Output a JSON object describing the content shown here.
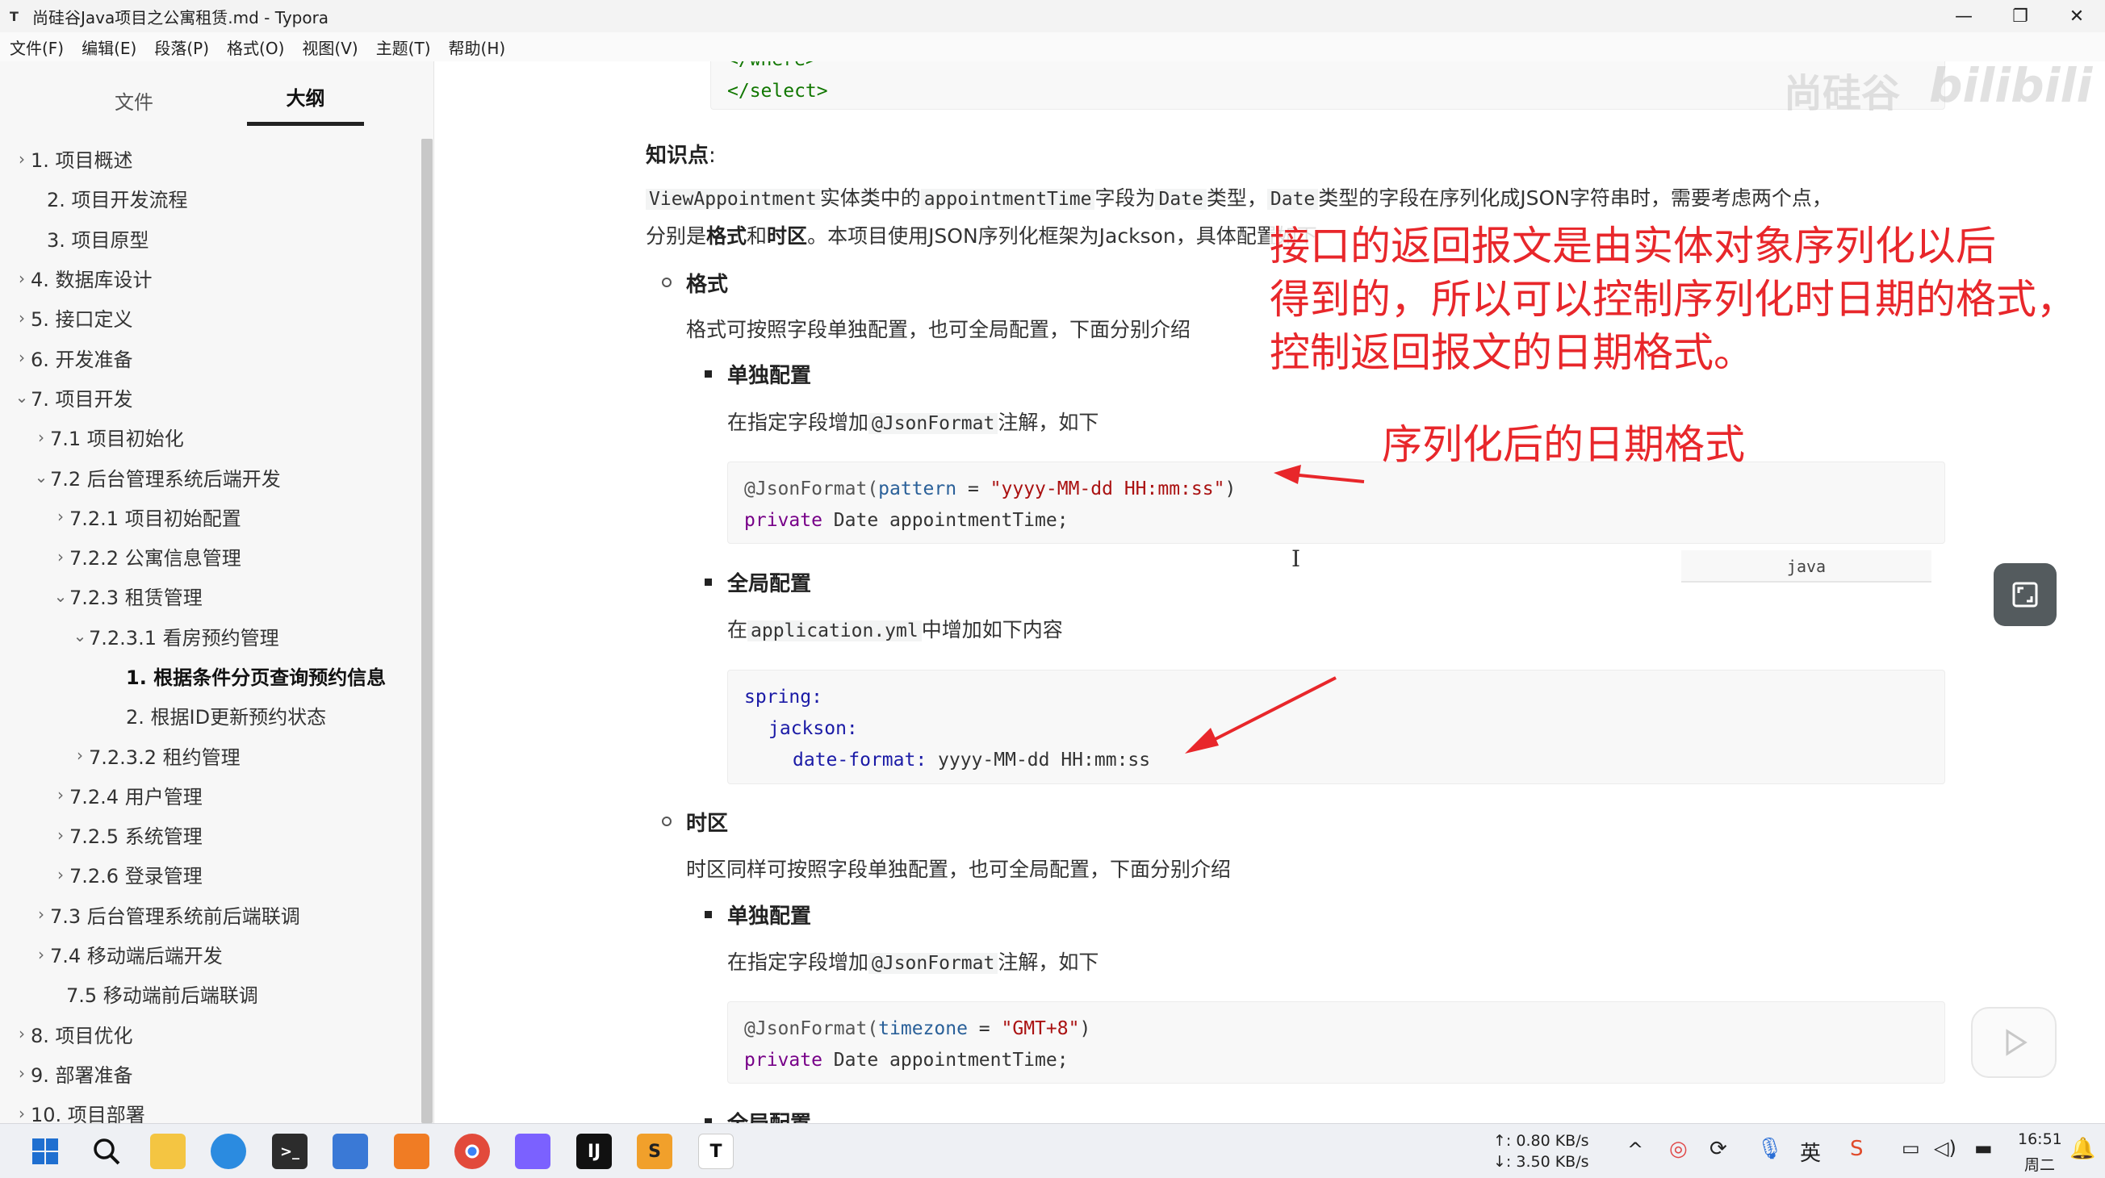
{
  "window": {
    "title": "尚硅谷Java项目之公寓租赁.md - Typora",
    "app_icon": "T",
    "controls": [
      "—",
      "❐",
      "✕"
    ]
  },
  "menu": [
    "文件(F)",
    "编辑(E)",
    "段落(P)",
    "格式(O)",
    "视图(V)",
    "主题(T)",
    "帮助(H)"
  ],
  "sidebar": {
    "tabs": [
      "文件",
      "大纲"
    ],
    "active_tab": "大纲",
    "outline": [
      {
        "label": "1. 项目概述",
        "chevron": "›"
      },
      {
        "label": "2. 项目开发流程",
        "chevron": ""
      },
      {
        "label": "3. 项目原型",
        "chevron": ""
      },
      {
        "label": "4. 数据库设计",
        "chevron": "›"
      },
      {
        "label": "5. 接口定义",
        "chevron": "›"
      },
      {
        "label": "6. 开发准备",
        "chevron": "›"
      },
      {
        "label": "7. 项目开发",
        "chevron": "⌄"
      },
      {
        "label": "7.1 项目初始化",
        "chevron": "›"
      },
      {
        "label": "7.2 后台管理系统后端开发",
        "chevron": "⌄"
      },
      {
        "label": "7.2.1 项目初始配置",
        "chevron": "›"
      },
      {
        "label": "7.2.2 公寓信息管理",
        "chevron": "›"
      },
      {
        "label": "7.2.3 租赁管理",
        "chevron": "⌄"
      },
      {
        "label": "7.2.3.1 看房预约管理",
        "chevron": "⌄"
      },
      {
        "label": "1. 根据条件分页查询预约信息",
        "chevron": ""
      },
      {
        "label": "2. 根据ID更新预约状态",
        "chevron": ""
      },
      {
        "label": "7.2.3.2 租约管理",
        "chevron": "›"
      },
      {
        "label": "7.2.4 用户管理",
        "chevron": "›"
      },
      {
        "label": "7.2.5 系统管理",
        "chevron": "›"
      },
      {
        "label": "7.2.6 登录管理",
        "chevron": "›"
      },
      {
        "label": "7.3 后台管理系统前后端联调",
        "chevron": "›"
      },
      {
        "label": "7.4 移动端后端开发",
        "chevron": "›"
      },
      {
        "label": "7.5 移动端前后端联调",
        "chevron": ""
      },
      {
        "label": "8. 项目优化",
        "chevron": "›"
      },
      {
        "label": "9. 部署准备",
        "chevron": "›"
      },
      {
        "label": "10. 项目部署",
        "chevron": "›"
      }
    ]
  },
  "doc": {
    "top_code_partial": "</where>",
    "top_code_line": "</select>",
    "knowledge_title": "知识点",
    "knowledge_colon": ":",
    "p1": {
      "c1": "ViewAppointment",
      "t1": "实体类中的",
      "c2": "appointmentTime",
      "t2": "字段为",
      "c3": "Date",
      "t3": "类型，",
      "c4": "Date",
      "t4": "类型的字段在序列化成JSON字符串时，需要考虑两个点，"
    },
    "p2": {
      "t1": "分别是",
      "b1": "格式",
      "t2": "和",
      "b2": "时区",
      "t3": "。本项目使用JSON序列化框架为Jackson，具体配置如下"
    },
    "format_heading": "格式",
    "format_desc": "格式可按照字段单独配置，也可全局配置，下面分别介绍",
    "single_config": "单独配置",
    "single_desc_pre": "在指定字段增加",
    "single_desc_code": "@JsonFormat",
    "single_desc_post": "注解，如下",
    "code1": {
      "l1_ann": "@JsonFormat(",
      "l1_attr": "pattern",
      "l1_eq": " = ",
      "l1_str": "\"yyyy-MM-dd HH:mm:ss\"",
      "l1_close": ")",
      "l2_kw": "private",
      "l2_rest": " Date appointmentTime;"
    },
    "lang_tag": "java",
    "global_config": "全局配置",
    "global_desc_pre": "在",
    "global_desc_code": "application.yml",
    "global_desc_post": "中增加如下内容",
    "yaml": {
      "l1": "spring:",
      "l2": "jackson:",
      "l3_key": "date-format:",
      "l3_val": " yyyy-MM-dd HH:mm:ss"
    },
    "tz_heading": "时区",
    "tz_desc": "时区同样可按照字段单独配置，也可全局配置，下面分别介绍",
    "tz_single_config": "单独配置",
    "tz_single_desc_pre": "在指定字段增加",
    "tz_single_desc_code": "@JsonFormat",
    "tz_single_desc_post": "注解，如下",
    "code3": {
      "l1_ann": "@JsonFormat(",
      "l1_attr": "timezone",
      "l1_eq": " = ",
      "l1_str": "\"GMT+8\"",
      "l1_close": ")",
      "l2_kw": "private",
      "l2_rest": " Date appointmentTime;"
    },
    "bottom_partial": "全局配置"
  },
  "annotations": {
    "big_note_lines": [
      "接口的返回报文是由实体对象序列化以后",
      "得到的，所以可以控制序列化时日期的格式，",
      "控制返回报文的日期格式。"
    ],
    "small_note": "序列化后的日期格式",
    "color": "#e8272b"
  },
  "watermark": {
    "text1": "尚硅谷",
    "text2": "bilibili"
  },
  "taskbar": {
    "net_up": "↑: 0.80 KB/s",
    "net_down": "↓: 3.50 KB/s",
    "time": "16:51",
    "day": "周二"
  }
}
